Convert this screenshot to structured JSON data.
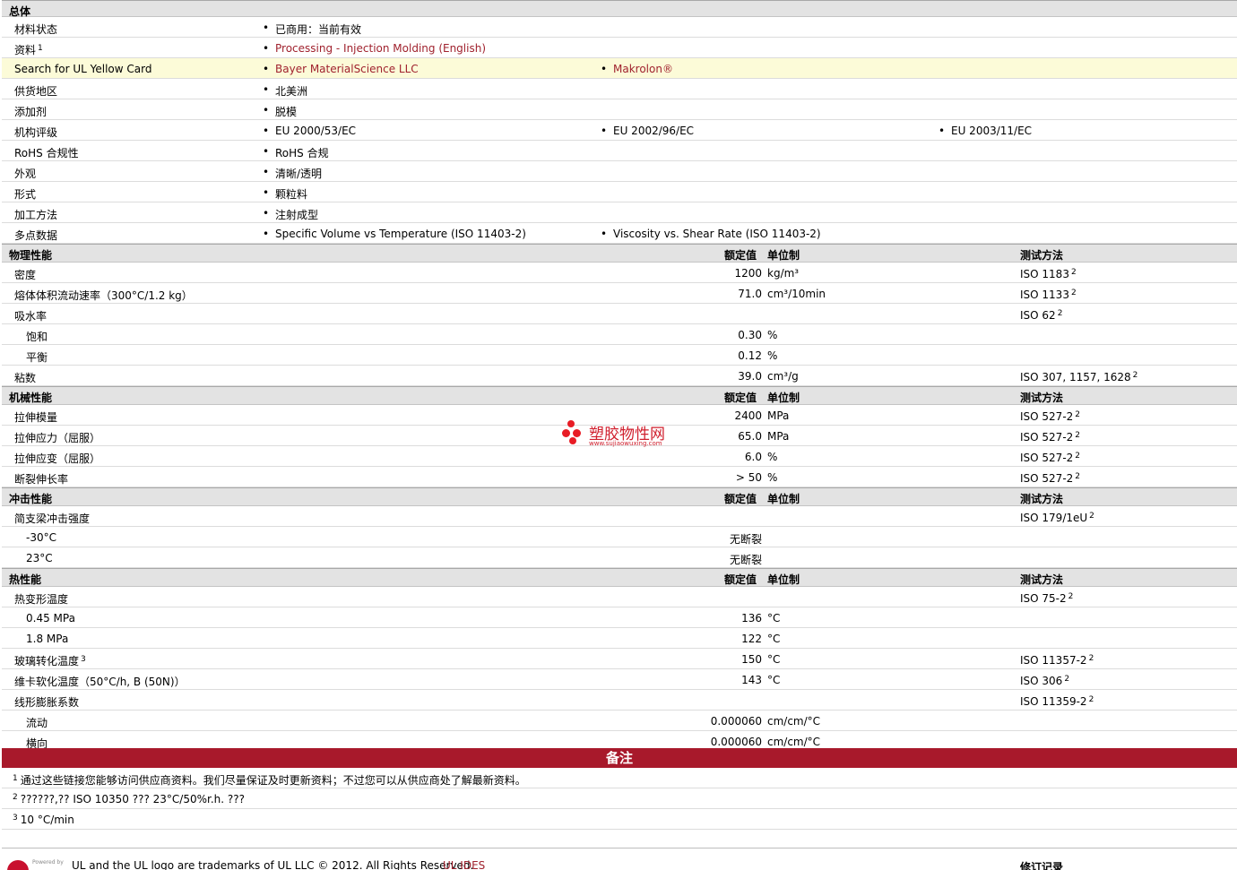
{
  "general": {
    "section_title": "总体",
    "rows": [
      {
        "label": "材料状态",
        "values": [
          "已商用：当前有效"
        ]
      },
      {
        "label": "资料",
        "label_sup": "1",
        "values": [
          "Processing - Injection Molding (English)"
        ],
        "link": true
      },
      {
        "label": "Search for UL Yellow Card",
        "values": [
          "Bayer MaterialScience LLC",
          "Makrolon®"
        ],
        "link": true,
        "highlight": true
      },
      {
        "label": "供货地区",
        "values": [
          "北美洲"
        ]
      },
      {
        "label": "添加剂",
        "values": [
          "脱模"
        ]
      },
      {
        "label": "机构评级",
        "values": [
          "EU 2000/53/EC",
          "EU 2002/96/EC",
          "EU 2003/11/EC"
        ]
      },
      {
        "label": "RoHS 合规性",
        "values": [
          "RoHS 合规"
        ]
      },
      {
        "label": "外观",
        "values": [
          "清晰/透明"
        ]
      },
      {
        "label": "形式",
        "values": [
          "颗粒料"
        ]
      },
      {
        "label": "加工方法",
        "values": [
          "注射成型"
        ]
      },
      {
        "label": "多点数据",
        "values": [
          "Specific Volume vs Temperature (ISO 11403-2)",
          "Viscosity vs. Shear Rate (ISO 11403-2)"
        ]
      }
    ]
  },
  "column_headers": {
    "value": "额定值",
    "unit": "单位制",
    "method": "测试方法"
  },
  "physical": {
    "section_title": "物理性能",
    "rows": [
      {
        "label": "密度",
        "value": "1200",
        "unit": "kg/m³",
        "method": "ISO 1183",
        "sup": "2"
      },
      {
        "label": "熔体体积流动速率（300°C/1.2 kg）",
        "value": "71.0",
        "unit": "cm³/10min",
        "method": "ISO 1133",
        "sup": "2"
      },
      {
        "label": "吸水率",
        "value": "",
        "unit": "",
        "method": "ISO 62",
        "sup": "2"
      },
      {
        "label": "饱和",
        "indent": true,
        "value": "0.30",
        "unit": "%",
        "method": ""
      },
      {
        "label": "平衡",
        "indent": true,
        "value": "0.12",
        "unit": "%",
        "method": ""
      },
      {
        "label": "粘数",
        "value": "39.0",
        "unit": "cm³/g",
        "method": "ISO 307, 1157, 1628",
        "sup": "2"
      }
    ]
  },
  "mechanical": {
    "section_title": "机械性能",
    "rows": [
      {
        "label": "拉伸模量",
        "value": "2400",
        "unit": "MPa",
        "method": "ISO 527-2",
        "sup": "2"
      },
      {
        "label": "拉伸应力（屈服）",
        "value": "65.0",
        "unit": "MPa",
        "method": "ISO 527-2",
        "sup": "2"
      },
      {
        "label": "拉伸应变（屈服）",
        "value": "6.0",
        "unit": "%",
        "method": "ISO 527-2",
        "sup": "2"
      },
      {
        "label": "断裂伸长率",
        "value": "> 50",
        "unit": "%",
        "method": "ISO 527-2",
        "sup": "2"
      }
    ]
  },
  "impact": {
    "section_title": "冲击性能",
    "rows": [
      {
        "label": "简支梁冲击强度",
        "value": "",
        "unit": "",
        "method": "ISO 179/1eU",
        "sup": "2"
      },
      {
        "label": "-30°C",
        "indent": true,
        "value": "无断裂",
        "unit": "",
        "method": ""
      },
      {
        "label": "23°C",
        "indent": true,
        "value": "无断裂",
        "unit": "",
        "method": ""
      }
    ]
  },
  "thermal": {
    "section_title": "热性能",
    "rows": [
      {
        "label": "热变形温度",
        "value": "",
        "unit": "",
        "method": "ISO 75-2",
        "sup": "2"
      },
      {
        "label": "0.45 MPa",
        "indent": true,
        "value": "136",
        "unit": "°C",
        "method": ""
      },
      {
        "label": "1.8 MPa",
        "indent": true,
        "value": "122",
        "unit": "°C",
        "method": ""
      },
      {
        "label": "玻璃转化温度",
        "label_sup": "3",
        "value": "150",
        "unit": "°C",
        "method": "ISO 11357-2",
        "sup": "2"
      },
      {
        "label": "维卡软化温度（50°C/h, B (50N)）",
        "value": "143",
        "unit": "°C",
        "method": "ISO 306",
        "sup": "2"
      },
      {
        "label": "线形膨胀系数",
        "value": "",
        "unit": "",
        "method": "ISO 11359-2",
        "sup": "2"
      },
      {
        "label": "流动",
        "indent": true,
        "value": "0.000060",
        "unit": "cm/cm/°C",
        "method": ""
      },
      {
        "label": "横向",
        "indent": true,
        "value": "0.000060",
        "unit": "cm/cm/°C",
        "method": ""
      }
    ]
  },
  "remarks": {
    "title": "备注",
    "notes": [
      {
        "num": "1",
        "text": "通过这些链接您能够访问供应商资料。我们尽量保证及时更新资料；不过您可以从供应商处了解最新资料。"
      },
      {
        "num": "2",
        "text": "??????,?? ISO 10350 ??? 23°C/50%r.h. ???"
      },
      {
        "num": "3",
        "text": "10 °C/min"
      }
    ]
  },
  "footer": {
    "powered_by": "Powered by",
    "trademark": "UL and the UL logo are trademarks of UL LLC © 2012. All Rights Reserved.",
    "link": "UL IDES",
    "revision": "修订记录"
  },
  "watermark": {
    "title": "塑胶物性网",
    "url": "www.sujiaowuxing.com"
  },
  "colors": {
    "link": "#a0222e",
    "remarks_bar": "#a8192b",
    "highlight": "#fcfbd8",
    "header_bg": "#e3e3e3"
  }
}
